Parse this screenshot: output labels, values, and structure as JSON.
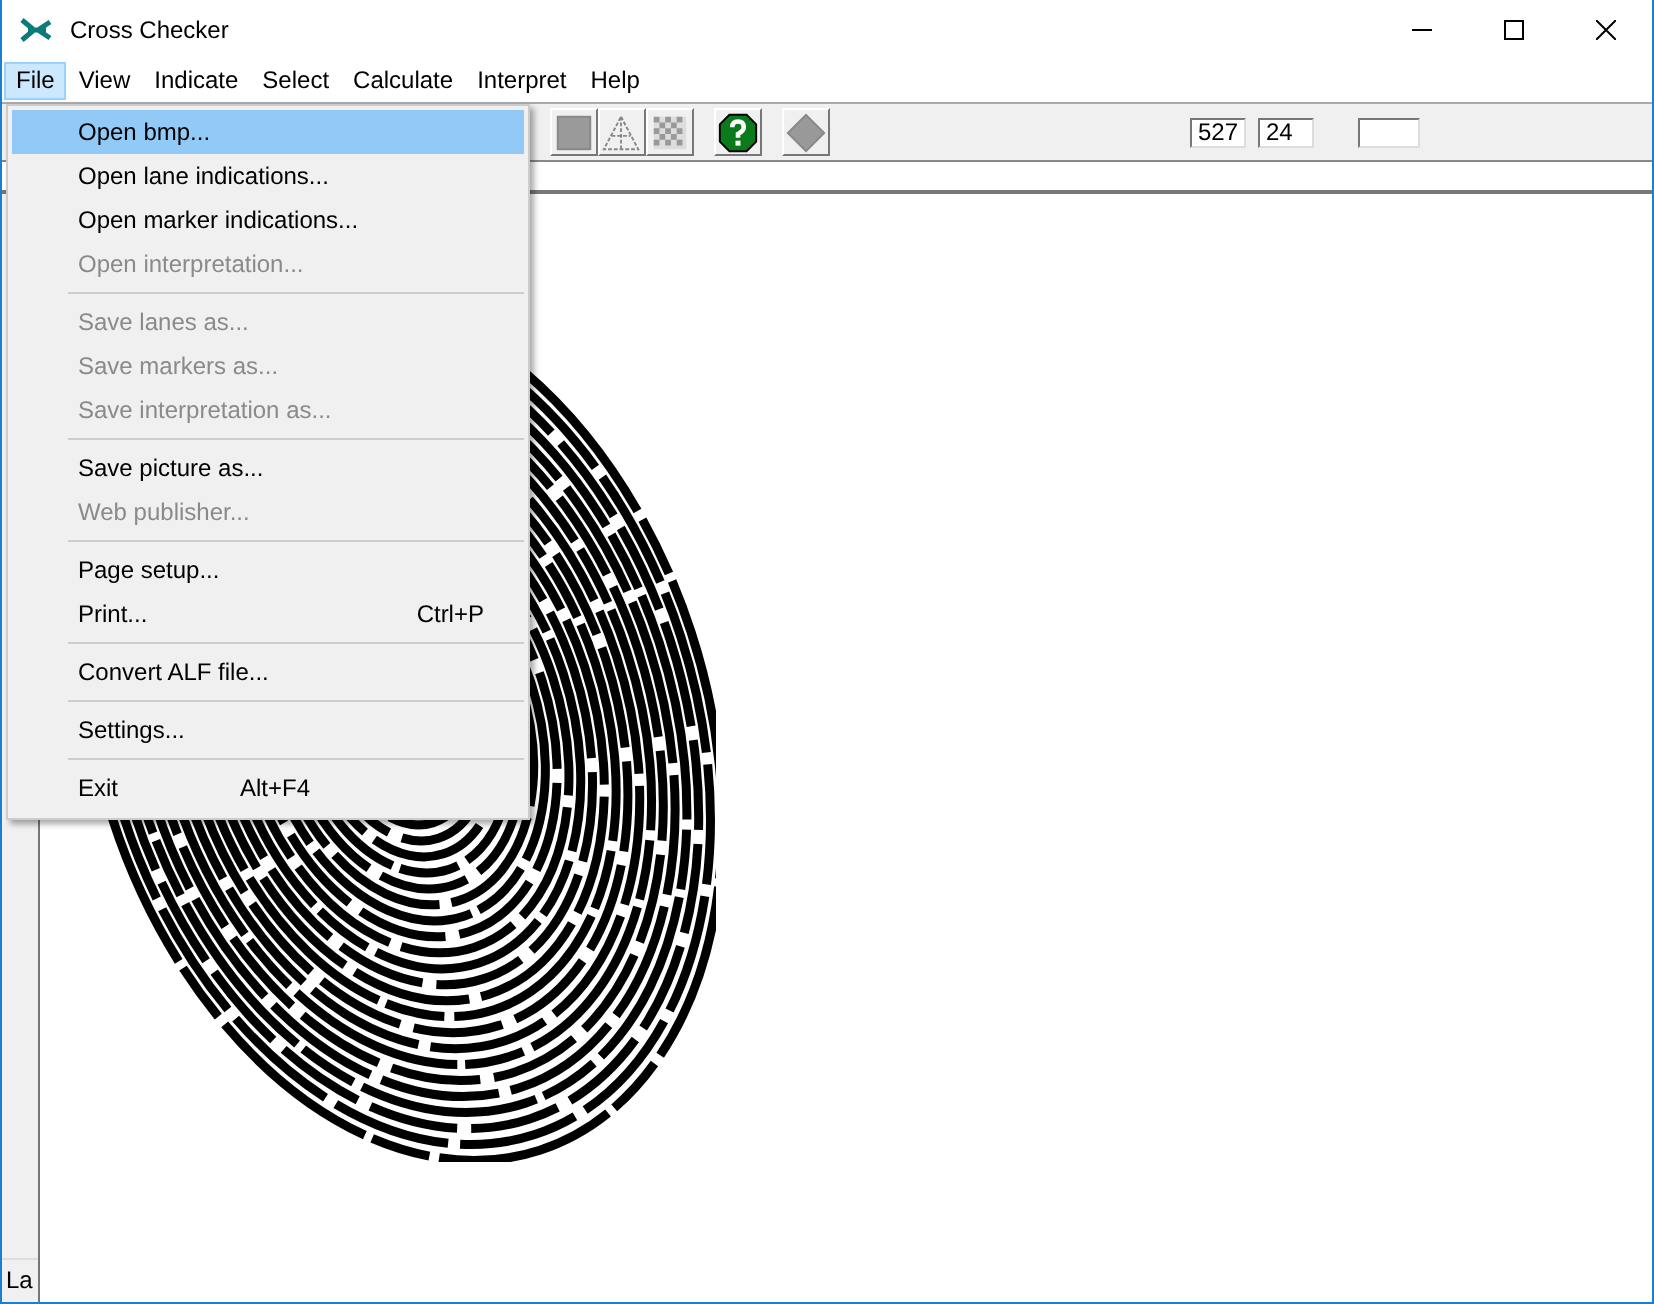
{
  "window": {
    "title": "Cross Checker"
  },
  "menu_bar": [
    {
      "label": "File",
      "selected": true
    },
    {
      "label": "View",
      "selected": false
    },
    {
      "label": "Indicate",
      "selected": false
    },
    {
      "label": "Select",
      "selected": false
    },
    {
      "label": "Calculate",
      "selected": false
    },
    {
      "label": "Interpret",
      "selected": false
    },
    {
      "label": "Help",
      "selected": false
    }
  ],
  "file_menu": [
    {
      "kind": "item",
      "label": "Open bmp...",
      "selected": true,
      "disabled": false
    },
    {
      "kind": "item",
      "label": "Open lane indications...",
      "selected": false,
      "disabled": false
    },
    {
      "kind": "item",
      "label": "Open marker indications...",
      "selected": false,
      "disabled": false
    },
    {
      "kind": "item",
      "label": "Open interpretation...",
      "selected": false,
      "disabled": true
    },
    {
      "kind": "separator"
    },
    {
      "kind": "item",
      "label": "Save lanes as...",
      "selected": false,
      "disabled": true
    },
    {
      "kind": "item",
      "label": "Save markers as...",
      "selected": false,
      "disabled": true
    },
    {
      "kind": "item",
      "label": "Save interpretation as...",
      "selected": false,
      "disabled": true
    },
    {
      "kind": "separator"
    },
    {
      "kind": "item",
      "label": "Save picture as...",
      "selected": false,
      "disabled": false
    },
    {
      "kind": "item",
      "label": "Web publisher...",
      "selected": false,
      "disabled": true
    },
    {
      "kind": "separator"
    },
    {
      "kind": "item",
      "label": "Page setup...",
      "selected": false,
      "disabled": false
    },
    {
      "kind": "item",
      "label": "Print...",
      "shortcut": "Ctrl+P",
      "selected": false,
      "disabled": false
    },
    {
      "kind": "separator"
    },
    {
      "kind": "item",
      "label": "Convert ALF file...",
      "selected": false,
      "disabled": false
    },
    {
      "kind": "separator"
    },
    {
      "kind": "item",
      "label": "Settings...",
      "selected": false,
      "disabled": false
    },
    {
      "kind": "separator"
    },
    {
      "kind": "item",
      "label": "Exit",
      "shortcut": "Alt+F4",
      "selected": false,
      "disabled": false
    }
  ],
  "toolbar": {
    "buttons": [
      {
        "kind": "square"
      },
      {
        "kind": "triangle"
      },
      {
        "kind": "checker"
      },
      {
        "kind": "gap"
      },
      {
        "kind": "help"
      },
      {
        "kind": "gap"
      },
      {
        "kind": "diamond"
      }
    ],
    "fields": [
      {
        "kind": "narrow",
        "value": "527"
      },
      {
        "kind": "narrow",
        "value": "24"
      },
      {
        "kind": "wide"
      }
    ]
  },
  "side_panel": {
    "label": "La"
  }
}
